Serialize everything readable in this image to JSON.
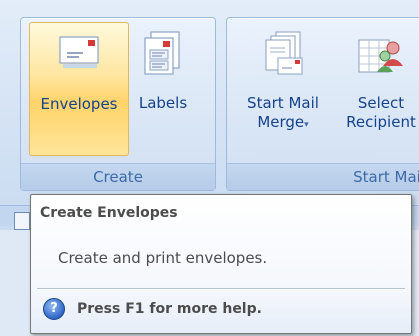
{
  "ribbon": {
    "groups": [
      {
        "caption": "Create",
        "buttons": [
          {
            "label": "Envelopes",
            "icon": "envelope-icon",
            "state": "hover"
          },
          {
            "label": "Labels",
            "icon": "labels-icon"
          }
        ]
      },
      {
        "caption": "Start Mail",
        "buttons": [
          {
            "line1": "Start Mail",
            "line2": "Merge",
            "icon": "mail-merge-icon",
            "dropdown": "▾"
          },
          {
            "line1": "Select",
            "line2": "Recipient",
            "icon": "select-recipients-icon"
          }
        ]
      }
    ]
  },
  "tooltip": {
    "title": "Create Envelopes",
    "description": "Create and print envelopes.",
    "help_icon": "help-icon",
    "help_glyph": "?",
    "help_text": "Press F1 for more help."
  },
  "colors": {
    "ribbon_text": "#15428b",
    "caption_text": "#3e6aaa",
    "hover_fill": "#ffd36a",
    "tooltip_text": "#4c4c4c"
  }
}
